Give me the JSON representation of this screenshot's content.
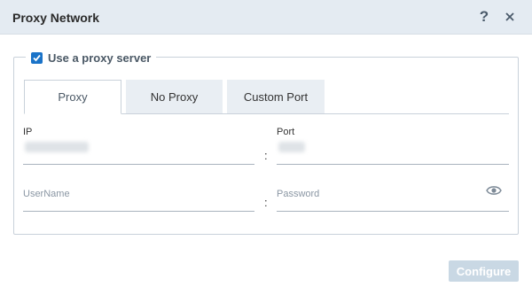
{
  "dialog": {
    "title": "Proxy Network",
    "help_icon": "question-mark-icon",
    "close_icon": "close-icon"
  },
  "proxy_toggle": {
    "label": "Use a proxy server",
    "checked": true,
    "accent_color": "#1a73c8"
  },
  "tabs": [
    {
      "label": "Proxy",
      "active": true
    },
    {
      "label": "No Proxy",
      "active": false
    },
    {
      "label": "Custom Port",
      "active": false
    }
  ],
  "form": {
    "ip_label": "IP",
    "port_label": "Port",
    "separator": ":",
    "username_placeholder": "UserName",
    "password_placeholder": "Password",
    "password_toggle_icon": "eye-icon"
  },
  "footer": {
    "configure_label": "Configure"
  }
}
